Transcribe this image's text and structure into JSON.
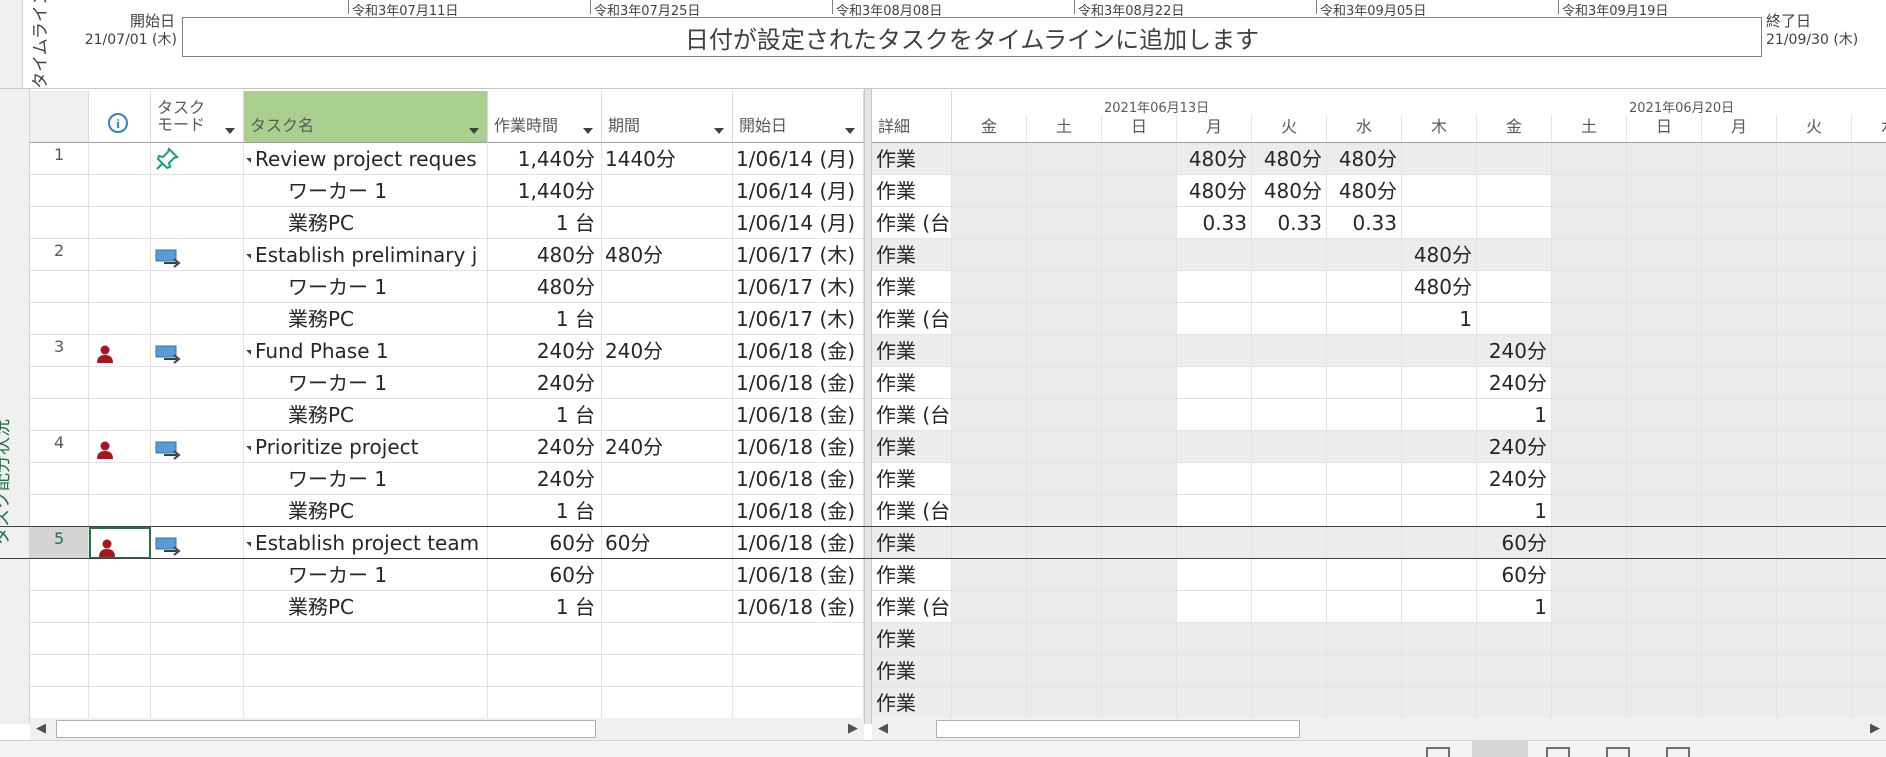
{
  "timeline": {
    "side_label": "タイムライン",
    "start_label": "開始日",
    "start_date": "21/07/01 (木)",
    "end_label": "終了日",
    "end_date": "21/09/30 (木)",
    "bar_text": "日付が設定されたタスクをタイムラインに追加します",
    "dates": [
      "令和3年07月11日",
      "令和3年07月25日",
      "令和3年08月08日",
      "令和3年08月22日",
      "令和3年09月05日",
      "令和3年09月19日"
    ]
  },
  "view_label": "タスク配分状況",
  "columns": {
    "info": "i",
    "mode": [
      "タスク",
      "モード"
    ],
    "name": "タスク名",
    "work": "作業時間",
    "duration": "期間",
    "start": "開始日"
  },
  "calendar": {
    "details_label": "詳細",
    "week1": "2021年06月13日",
    "week2": "2021年06月20日",
    "days": [
      "金",
      "土",
      "日",
      "月",
      "火",
      "水",
      "木",
      "金",
      "土",
      "日",
      "月",
      "火",
      "水"
    ]
  },
  "rows": [
    {
      "id": "1",
      "icon": "pin",
      "name": "Review project reques",
      "summary": true,
      "work": "1,440分",
      "duration": "1440分",
      "start": "1/06/14 (月)",
      "detail": "作業",
      "cells": [
        "",
        "",
        "",
        "480分",
        "480分",
        "480分",
        "",
        "",
        "",
        "",
        "",
        "",
        ""
      ]
    },
    {
      "id": "",
      "icon": "",
      "name": "ワーカー 1",
      "summary": false,
      "work": "1,440分",
      "duration": "",
      "start": "1/06/14 (月)",
      "detail": "作業",
      "cells": [
        "",
        "",
        "",
        "480分",
        "480分",
        "480分",
        "",
        "",
        "",
        "",
        "",
        "",
        ""
      ]
    },
    {
      "id": "",
      "icon": "",
      "name": "業務PC",
      "summary": false,
      "work": "1 台",
      "duration": "",
      "start": "1/06/14 (月)",
      "detail": "作業 (台",
      "cells": [
        "",
        "",
        "",
        "0.33",
        "0.33",
        "0.33",
        "",
        "",
        "",
        "",
        "",
        "",
        ""
      ]
    },
    {
      "id": "2",
      "icon": "auto",
      "name": "Establish preliminary j",
      "summary": true,
      "work": "480分",
      "duration": "480分",
      "start": "1/06/17 (木)",
      "detail": "作業",
      "cells": [
        "",
        "",
        "",
        "",
        "",
        "",
        "480分",
        "",
        "",
        "",
        "",
        "",
        ""
      ]
    },
    {
      "id": "",
      "icon": "",
      "name": "ワーカー 1",
      "summary": false,
      "work": "480分",
      "duration": "",
      "start": "1/06/17 (木)",
      "detail": "作業",
      "cells": [
        "",
        "",
        "",
        "",
        "",
        "",
        "480分",
        "",
        "",
        "",
        "",
        "",
        ""
      ]
    },
    {
      "id": "",
      "icon": "",
      "name": "業務PC",
      "summary": false,
      "work": "1 台",
      "duration": "",
      "start": "1/06/17 (木)",
      "detail": "作業 (台",
      "cells": [
        "",
        "",
        "",
        "",
        "",
        "",
        "1",
        "",
        "",
        "",
        "",
        "",
        ""
      ]
    },
    {
      "id": "3",
      "icon": "auto",
      "person": true,
      "name": "Fund Phase 1",
      "summary": true,
      "work": "240分",
      "duration": "240分",
      "start": "1/06/18 (金)",
      "detail": "作業",
      "cells": [
        "",
        "",
        "",
        "",
        "",
        "",
        "",
        "240分",
        "",
        "",
        "",
        "",
        ""
      ]
    },
    {
      "id": "",
      "icon": "",
      "name": "ワーカー 1",
      "summary": false,
      "work": "240分",
      "duration": "",
      "start": "1/06/18 (金)",
      "detail": "作業",
      "cells": [
        "",
        "",
        "",
        "",
        "",
        "",
        "",
        "240分",
        "",
        "",
        "",
        "",
        ""
      ]
    },
    {
      "id": "",
      "icon": "",
      "name": "業務PC",
      "summary": false,
      "work": "1 台",
      "duration": "",
      "start": "1/06/18 (金)",
      "detail": "作業 (台",
      "cells": [
        "",
        "",
        "",
        "",
        "",
        "",
        "",
        "1",
        "",
        "",
        "",
        "",
        ""
      ]
    },
    {
      "id": "4",
      "icon": "auto",
      "person": true,
      "name": "Prioritize project",
      "summary": true,
      "work": "240分",
      "duration": "240分",
      "start": "1/06/18 (金)",
      "detail": "作業",
      "cells": [
        "",
        "",
        "",
        "",
        "",
        "",
        "",
        "240分",
        "",
        "",
        "",
        "",
        ""
      ]
    },
    {
      "id": "",
      "icon": "",
      "name": "ワーカー 1",
      "summary": false,
      "work": "240分",
      "duration": "",
      "start": "1/06/18 (金)",
      "detail": "作業",
      "cells": [
        "",
        "",
        "",
        "",
        "",
        "",
        "",
        "240分",
        "",
        "",
        "",
        "",
        ""
      ]
    },
    {
      "id": "",
      "icon": "",
      "name": "業務PC",
      "summary": false,
      "work": "1 台",
      "duration": "",
      "start": "1/06/18 (金)",
      "detail": "作業 (台",
      "cells": [
        "",
        "",
        "",
        "",
        "",
        "",
        "",
        "1",
        "",
        "",
        "",
        "",
        ""
      ]
    },
    {
      "id": "5",
      "icon": "auto",
      "person": true,
      "selected": true,
      "name": "Establish project team",
      "summary": true,
      "work": "60分",
      "duration": "60分",
      "start": "1/06/18 (金)",
      "detail": "作業",
      "cells": [
        "",
        "",
        "",
        "",
        "",
        "",
        "",
        "60分",
        "",
        "",
        "",
        "",
        ""
      ]
    },
    {
      "id": "",
      "icon": "",
      "name": "ワーカー 1",
      "summary": false,
      "work": "60分",
      "duration": "",
      "start": "1/06/18 (金)",
      "detail": "作業",
      "cells": [
        "",
        "",
        "",
        "",
        "",
        "",
        "",
        "60分",
        "",
        "",
        "",
        "",
        ""
      ]
    },
    {
      "id": "",
      "icon": "",
      "name": "業務PC",
      "summary": false,
      "work": "1 台",
      "duration": "",
      "start": "1/06/18 (金)",
      "detail": "作業 (台",
      "cells": [
        "",
        "",
        "",
        "",
        "",
        "",
        "",
        "1",
        "",
        "",
        "",
        "",
        ""
      ]
    },
    {
      "id": "",
      "icon": "",
      "name": "",
      "summary": false,
      "work": "",
      "duration": "",
      "start": "",
      "detail": "作業",
      "cells": [
        "",
        "",
        "",
        "",
        "",
        "",
        "",
        "",
        "",
        "",
        "",
        "",
        ""
      ]
    },
    {
      "id": "",
      "icon": "",
      "name": "",
      "summary": false,
      "work": "",
      "duration": "",
      "start": "",
      "detail": "作業",
      "cells": [
        "",
        "",
        "",
        "",
        "",
        "",
        "",
        "",
        "",
        "",
        "",
        "",
        ""
      ]
    },
    {
      "id": "",
      "icon": "",
      "name": "",
      "summary": false,
      "work": "",
      "duration": "",
      "start": "",
      "detail": "作業",
      "cells": [
        "",
        "",
        "",
        "",
        "",
        "",
        "",
        "",
        "",
        "",
        "",
        "",
        ""
      ]
    }
  ],
  "colors": {
    "accent_green": "#217346",
    "name_header": "#a9d08e",
    "person_icon": "#a5161f",
    "pin": "#1a9c8c",
    "shade": "#ececec"
  }
}
